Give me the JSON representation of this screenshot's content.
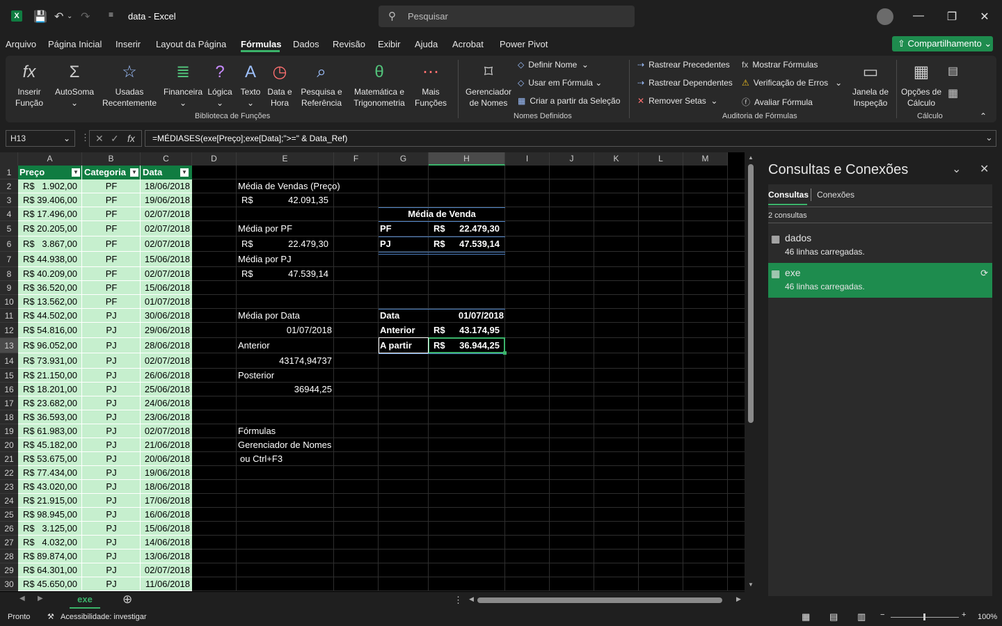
{
  "titlebar": {
    "doc_title": "data  -  Excel",
    "search_placeholder": "Pesquisar"
  },
  "menu": {
    "tabs": [
      "Arquivo",
      "Página Inicial",
      "Inserir",
      "Layout da Página",
      "Fórmulas",
      "Dados",
      "Revisão",
      "Exibir",
      "Ajuda",
      "Acrobat",
      "Power Pivot"
    ],
    "share_label": "Compartilhamento"
  },
  "ribbon": {
    "insert_function": "Inserir\nFunção",
    "autosum": "AutoSoma",
    "recent": "Usadas\nRecentemente",
    "financial": "Financeira",
    "logical": "Lógica",
    "text": "Texto",
    "datetime": "Data e\nHora",
    "lookup": "Pesquisa e\nReferência",
    "math": "Matemática e\nTrigonometria",
    "more": "Mais\nFunções",
    "lib_label": "Biblioteca de Funções",
    "name_manager": "Gerenciador\nde Nomes",
    "define_name": "Definir Nome",
    "use_in_formula": "Usar em Fórmula",
    "create_from_sel": "Criar a partir da Seleção",
    "names_label": "Nomes Definidos",
    "trace_prec": "Rastrear Precedentes",
    "trace_dep": "Rastrear Dependentes",
    "remove_arrows": "Remover Setas",
    "show_formulas": "Mostrar Fórmulas",
    "error_check": "Verificação de Erros",
    "eval_formula": "Avaliar Fórmula",
    "audit_label": "Auditoria de Fórmulas",
    "watch": "Janela de\nInspeção",
    "calc_options": "Opções de\nCálculo",
    "calc_label": "Cálculo"
  },
  "formula_bar": {
    "name_box": "H13",
    "formula": "=MÉDIASES(exe[Preço];exe[Data];\">=\" & Data_Ref)"
  },
  "grid": {
    "columns": [
      "A",
      "B",
      "C",
      "D",
      "E",
      "F",
      "G",
      "H",
      "I",
      "J",
      "K",
      "L",
      "M"
    ],
    "rows": [
      "1",
      "2",
      "3",
      "4",
      "5",
      "6",
      "7",
      "8",
      "9",
      "10",
      "11",
      "12",
      "13",
      "14",
      "15",
      "16",
      "17",
      "18",
      "19",
      "20",
      "21",
      "22",
      "23",
      "24",
      "25",
      "26",
      "27",
      "28",
      "29",
      "30"
    ],
    "table_headers": [
      "Preço",
      "Categoria",
      "Data"
    ],
    "table_rows": [
      [
        "R$",
        "1.902,00",
        "PF",
        "18/06/2018"
      ],
      [
        "R$",
        "39.406,00",
        "PF",
        "19/06/2018"
      ],
      [
        "R$",
        "17.496,00",
        "PF",
        "02/07/2018"
      ],
      [
        "R$",
        "20.205,00",
        "PF",
        "02/07/2018"
      ],
      [
        "R$",
        "3.867,00",
        "PF",
        "02/07/2018"
      ],
      [
        "R$",
        "44.938,00",
        "PF",
        "15/06/2018"
      ],
      [
        "R$",
        "40.209,00",
        "PF",
        "02/07/2018"
      ],
      [
        "R$",
        "36.520,00",
        "PF",
        "15/06/2018"
      ],
      [
        "R$",
        "13.562,00",
        "PF",
        "01/07/2018"
      ],
      [
        "R$",
        "44.502,00",
        "PJ",
        "30/06/2018"
      ],
      [
        "R$",
        "54.816,00",
        "PJ",
        "29/06/2018"
      ],
      [
        "R$",
        "96.052,00",
        "PJ",
        "28/06/2018"
      ],
      [
        "R$",
        "73.931,00",
        "PJ",
        "02/07/2018"
      ],
      [
        "R$",
        "21.150,00",
        "PJ",
        "26/06/2018"
      ],
      [
        "R$",
        "18.201,00",
        "PJ",
        "25/06/2018"
      ],
      [
        "R$",
        "23.682,00",
        "PJ",
        "24/06/2018"
      ],
      [
        "R$",
        "36.593,00",
        "PJ",
        "23/06/2018"
      ],
      [
        "R$",
        "61.983,00",
        "PJ",
        "02/07/2018"
      ],
      [
        "R$",
        "45.182,00",
        "PJ",
        "21/06/2018"
      ],
      [
        "R$",
        "53.675,00",
        "PJ",
        "20/06/2018"
      ],
      [
        "R$",
        "77.434,00",
        "PJ",
        "19/06/2018"
      ],
      [
        "R$",
        "43.020,00",
        "PJ",
        "18/06/2018"
      ],
      [
        "R$",
        "21.915,00",
        "PJ",
        "17/06/2018"
      ],
      [
        "R$",
        "98.945,00",
        "PJ",
        "16/06/2018"
      ],
      [
        "R$",
        "3.125,00",
        "PJ",
        "15/06/2018"
      ],
      [
        "R$",
        "4.032,00",
        "PJ",
        "14/06/2018"
      ],
      [
        "R$",
        "89.874,00",
        "PJ",
        "13/06/2018"
      ],
      [
        "R$",
        "64.301,00",
        "PJ",
        "02/07/2018"
      ],
      [
        "R$",
        "45.650,00",
        "PJ",
        "11/06/2018"
      ]
    ],
    "e_col": {
      "e2": "Média de Vendas (Preço)",
      "e3_cur": "R$",
      "e3_val": "42.091,35",
      "e5": "Média por PF",
      "e6_cur": "R$",
      "e6_val": "22.479,30",
      "e7": "Média por PJ",
      "e8_cur": "R$",
      "e8_val": "47.539,14",
      "e11": "Média por Data",
      "e12": "01/07/2018",
      "e13": "Anterior",
      "e14": "43174,94737",
      "e15": "Posterior",
      "e16": "36944,25",
      "e19": "Fórmulas",
      "e20": "Gerenciador de Nomes",
      "e21": "ou Ctrl+F3"
    },
    "summary": {
      "h4": "Média de Venda",
      "g5": "PF",
      "g5_cur": "R$",
      "h5": "22.479,30",
      "g6": "PJ",
      "g6_cur": "R$",
      "h6": "47.539,14",
      "g11": "Data",
      "h11": "01/07/2018",
      "g12": "Anterior",
      "g12_cur": "R$",
      "h12": "43.174,95",
      "g13": "A partir",
      "g13_cur": "R$",
      "h13": "36.944,25"
    }
  },
  "sheet": {
    "tab": "exe"
  },
  "pane": {
    "title": "Consultas e Conexões",
    "tab_queries": "Consultas",
    "tab_connections": "Conexões",
    "count": "2 consultas",
    "queries": [
      {
        "name": "dados",
        "status": "46 linhas carregadas."
      },
      {
        "name": "exe",
        "status": "46 linhas carregadas."
      }
    ]
  },
  "status": {
    "ready": "Pronto",
    "accessibility": "Acessibilidade: investigar",
    "zoom": "100%"
  },
  "colors": {
    "accent": "#3bb36a",
    "table_header": "#107c41",
    "table_body": "#c6efce",
    "selected_query": "#1e8c4e"
  }
}
